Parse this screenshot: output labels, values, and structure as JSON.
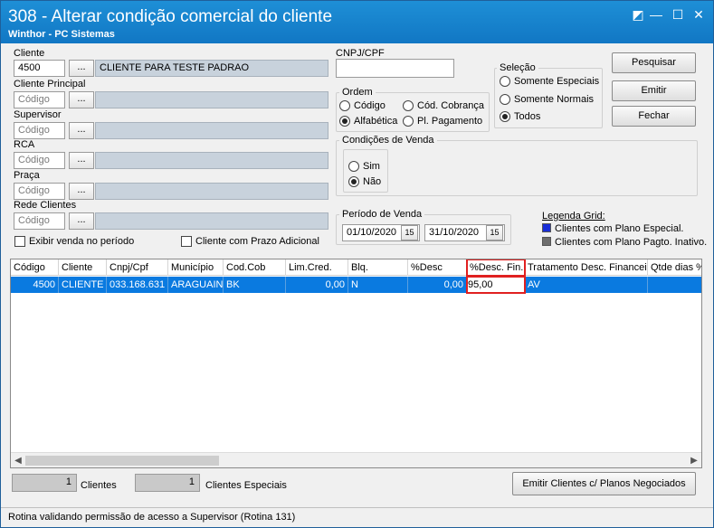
{
  "window": {
    "title": "308 - Alterar condição comercial do cliente",
    "subtitle": "Winthor - PC Sistemas",
    "controls": {
      "help": "◩",
      "minimize": "—",
      "maximize": "☐",
      "close": "✕"
    }
  },
  "filters": {
    "cliente": {
      "label": "Cliente",
      "code": "4500",
      "dots": "...",
      "name": "CLIENTE PARA TESTE PADRAO"
    },
    "cliente_principal": {
      "label": "Cliente Principal",
      "placeholder": "Código",
      "dots": "..."
    },
    "supervisor": {
      "label": "Supervisor",
      "placeholder": "Código",
      "dots": "..."
    },
    "rca": {
      "label": "RCA",
      "placeholder": "Código",
      "dots": "..."
    },
    "praca": {
      "label": "Praça",
      "placeholder": "Código",
      "dots": "..."
    },
    "rede_clientes": {
      "label": "Rede Clientes",
      "placeholder": "Código",
      "dots": "..."
    },
    "cnpj_label": "CNPJ/CPF",
    "exibir_venda": "Exibir venda no período",
    "prazo_adicional": "Cliente com Prazo Adicional"
  },
  "ordem": {
    "title": "Ordem",
    "options": [
      "Código",
      "Cód. Cobrança",
      "Alfabética",
      "Pl. Pagamento"
    ],
    "selected": "Alfabética"
  },
  "selecao": {
    "title": "Seleção",
    "options": [
      "Somente Especiais",
      "Somente Normais",
      "Todos"
    ],
    "selected": "Todos"
  },
  "condicoes": {
    "title": "Condições de Venda",
    "options": [
      "Sim",
      "Não"
    ],
    "selected": "Não"
  },
  "periodo": {
    "title": "Período de Venda",
    "start": "01/10/2020",
    "end": "31/10/2020",
    "cal_icon": "15"
  },
  "legenda": {
    "title": "Legenda Grid:",
    "items": [
      {
        "label": "Clientes com Plano Especial.",
        "color": "#1a2fd8"
      },
      {
        "label": "Clientes com Plano Pagto. Inativo.",
        "color": "#6e6e6e"
      }
    ]
  },
  "buttons": {
    "pesquisar": "Pesquisar",
    "emitir": "Emitir",
    "fechar": "Fechar",
    "emitir_planos": "Emitir Clientes c/ Planos Negociados"
  },
  "grid": {
    "columns": [
      "Código",
      "Cliente",
      "Cnpj/Cpf",
      "Município",
      "Cod.Cob",
      "Lim.Cred.",
      "Blq.",
      "%Desc",
      "%Desc. Fin.",
      "Tratamento Desc. Financeir",
      "Qtde dias %"
    ],
    "rows": [
      [
        "4500",
        "CLIENTE P",
        "033.168.631",
        "ARAGUAINA",
        "BK",
        "0,00",
        "N",
        "0,00",
        "95,00",
        "AV",
        ""
      ]
    ],
    "selection_color": "#0a7ae0"
  },
  "footer": {
    "clientes_count": "1",
    "clientes_label": "Clientes",
    "especiais_count": "1",
    "especiais_label": "Clientes Especiais"
  },
  "status": "Rotina validando permissão de acesso a Supervisor (Rotina 131)"
}
